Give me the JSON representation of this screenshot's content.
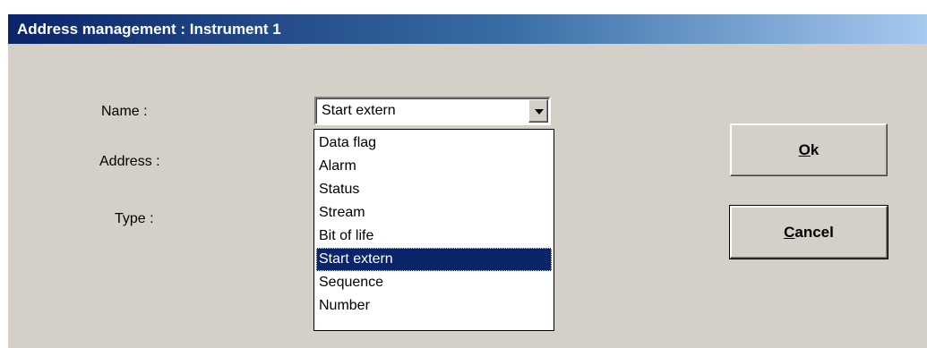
{
  "window": {
    "title": "Address management : Instrument 1"
  },
  "labels": {
    "name": "Name :",
    "address": "Address :",
    "type": "Type :"
  },
  "combo": {
    "value": "Start extern",
    "options": [
      "Data flag",
      "Alarm",
      "Status",
      "Stream",
      "Bit of life",
      "Start extern",
      "Sequence",
      "Number"
    ],
    "selected_index": 5
  },
  "buttons": {
    "ok": {
      "mnemonic": "O",
      "rest": "k"
    },
    "cancel": {
      "mnemonic": "C",
      "rest": "ancel"
    }
  },
  "colors": {
    "titlebar_start": "#0a246a",
    "titlebar_end": "#a6caf0",
    "selection": "#0a246a",
    "face": "#d4d0c8"
  }
}
